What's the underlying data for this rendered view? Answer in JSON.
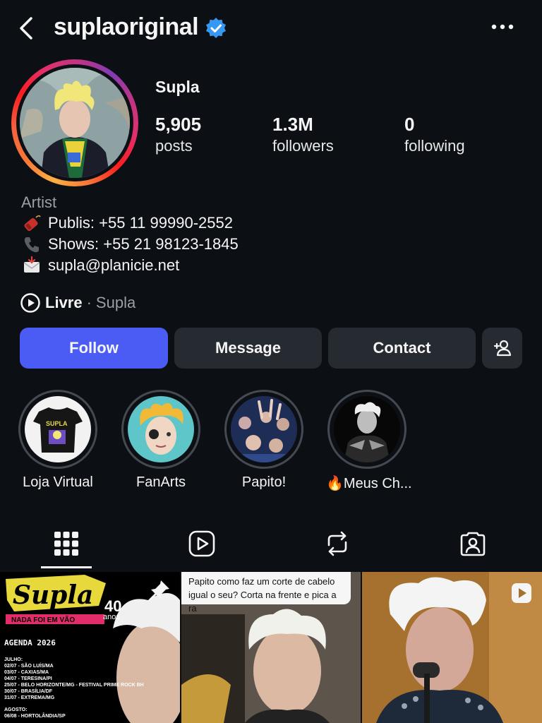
{
  "header": {
    "username": "suplaoriginal",
    "verified": true,
    "back_icon": "chevron-left-icon",
    "more_icon": "ellipsis-icon"
  },
  "profile": {
    "display_name": "Supla",
    "stats": [
      {
        "value": "5,905",
        "label": "posts"
      },
      {
        "value": "1.3M",
        "label": "followers"
      },
      {
        "value": "0",
        "label": "following"
      }
    ],
    "category": "Artist",
    "bio_lines": [
      {
        "icon": "firecracker-icon",
        "text": "Publis: +55 11 99990-2552"
      },
      {
        "icon": "telephone-icon",
        "text": "Shows: +55 21 98123-1845"
      },
      {
        "icon": "envelope-icon",
        "text": "supla@planicie.net"
      }
    ],
    "audio": {
      "title": "Livre",
      "separator": "·",
      "artist": "Supla"
    }
  },
  "actions": {
    "follow": "Follow",
    "message": "Message",
    "contact": "Contact",
    "add_person_icon": "add-person-icon"
  },
  "highlights": [
    {
      "label": "Loja Virtual"
    },
    {
      "label": "FanArts"
    },
    {
      "label": "Papito!"
    },
    {
      "label": "🔥Meus Ch..."
    }
  ],
  "tabs": [
    {
      "name": "grid-icon",
      "active": true
    },
    {
      "name": "reels-icon",
      "active": false
    },
    {
      "name": "reposts-icon",
      "active": false
    },
    {
      "name": "tagged-icon",
      "active": false
    }
  ],
  "posts": [
    {
      "title_art": "Supla",
      "years": "40",
      "years_label": "anos",
      "banner": "NADA FOI EM VÃO",
      "agenda_title": "AGENDA 2026",
      "month1": "JULHO:",
      "dates": [
        "02/07 - SÃO LUÍS/MA",
        "03/07 - CAXIAS/MA",
        "04/07 - TERESINA/PI",
        "25/07 - BELO HORIZONTE/MG - FESTIVAL PRIME ROCK BH",
        "30/07 - BRASÍLIA/DF",
        "31/07 - EXTREMA/MG"
      ],
      "month2": "AGOSTO:",
      "next": "06/08 - HORTOLÂNDIA/SP",
      "pinned": true
    },
    {
      "caption": "Papito como faz um corte de cabelo igual o seu? Corta na frente e pica a ra",
      "pinned": true
    },
    {
      "type": "reel"
    }
  ],
  "colors": {
    "background": "#0c0f14",
    "follow_button": "#4a5cf4",
    "secondary_button": "#262a31",
    "verified_badge": "#3897f0"
  }
}
